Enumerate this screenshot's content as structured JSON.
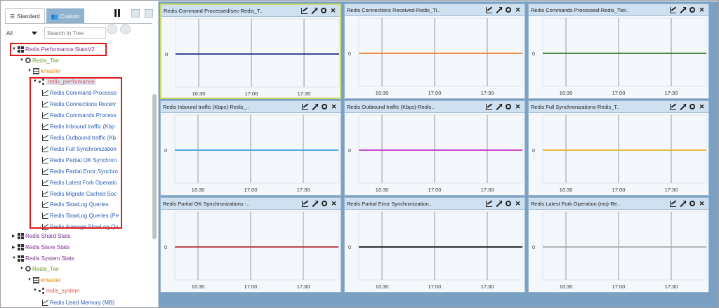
{
  "tabs": [
    {
      "label": "Standard",
      "active": true
    },
    {
      "label": "Custom",
      "active": false
    }
  ],
  "filter": {
    "selected": "All",
    "placeholder": "Search In Tree"
  },
  "tree": [
    {
      "label": "Redis Performance StatsV2",
      "color": "#7b2d8e",
      "icon": "dashboard-grid-icon",
      "indent": 0,
      "expanded": true
    },
    {
      "label": "Redis_Tier",
      "color": "#6e9f1f",
      "icon": "tier-gear-icon",
      "indent": 1,
      "expanded": true
    },
    {
      "label": "kmaster",
      "color": "#e08a00",
      "icon": "server-icon",
      "indent": 2,
      "expanded": true
    },
    {
      "label": "redis_performance",
      "color": "#d9534f",
      "icon": "share-node-icon",
      "indent": 3,
      "expanded": true,
      "selected": true
    },
    {
      "label": "Redis Command Processe",
      "color": "#2c5eb4",
      "icon": "graph-icon",
      "indent": 4
    },
    {
      "label": "Redis Connections Receiv",
      "color": "#2c5eb4",
      "icon": "graph-icon",
      "indent": 4
    },
    {
      "label": "Redis Commands Process",
      "color": "#2c5eb4",
      "icon": "graph-icon",
      "indent": 4
    },
    {
      "label": "Redis Inbound traffic (Kbp",
      "color": "#2c5eb4",
      "icon": "graph-icon",
      "indent": 4
    },
    {
      "label": "Redis Outbound traffic (Kb",
      "color": "#2c5eb4",
      "icon": "graph-icon",
      "indent": 4
    },
    {
      "label": "Redis Full Synchronization",
      "color": "#2c5eb4",
      "icon": "graph-icon",
      "indent": 4
    },
    {
      "label": "Redis Partial OK Synchron",
      "color": "#2c5eb4",
      "icon": "graph-icon",
      "indent": 4
    },
    {
      "label": "Redis Partial Error Synchro",
      "color": "#2c5eb4",
      "icon": "graph-icon",
      "indent": 4
    },
    {
      "label": "Redis Latest Fork Operatio",
      "color": "#2c5eb4",
      "icon": "graph-icon",
      "indent": 4
    },
    {
      "label": "Redis Migrate Cached Soc",
      "color": "#2c5eb4",
      "icon": "graph-icon",
      "indent": 4
    },
    {
      "label": "Redis SlowLog Queries",
      "color": "#2c5eb4",
      "icon": "graph-icon",
      "indent": 4
    },
    {
      "label": "Redis SlowLog Queries (Pe",
      "color": "#2c5eb4",
      "icon": "graph-icon",
      "indent": 4
    },
    {
      "label": "Redis Average SlowLog Qu",
      "color": "#2c5eb4",
      "icon": "graph-icon",
      "indent": 4
    },
    {
      "label": "Redis Shard Stats",
      "color": "#7b2d8e",
      "icon": "dashboard-grid-icon",
      "indent": 0,
      "expanded": false
    },
    {
      "label": "Redis Slave Stats",
      "color": "#7b2d8e",
      "icon": "dashboard-grid-icon",
      "indent": 0,
      "expanded": false
    },
    {
      "label": "Redis System Stats",
      "color": "#7b2d8e",
      "icon": "dashboard-grid-icon",
      "indent": 0,
      "expanded": true
    },
    {
      "label": "Redis_Tier",
      "color": "#6e9f1f",
      "icon": "tier-gear-icon",
      "indent": 1,
      "expanded": true
    },
    {
      "label": "kmaster",
      "color": "#e08a00",
      "icon": "server-icon",
      "indent": 2,
      "expanded": true
    },
    {
      "label": "redis_system",
      "color": "#d9534f",
      "icon": "share-node-icon",
      "indent": 3,
      "expanded": true
    },
    {
      "label": "Redis Used Memory (MB)",
      "color": "#2c5eb4",
      "icon": "graph-icon",
      "indent": 4
    }
  ],
  "widgets": [
    {
      "title": "Redis Command Processed/sec-Redis_T..",
      "line_color": "#1f2d8a",
      "selected": true
    },
    {
      "title": "Redis Connections Received-Redis_Ti..",
      "line_color": "#f07f2a"
    },
    {
      "title": "Redis Commands Processed-Redis_Tier..",
      "line_color": "#2a7a2a"
    },
    {
      "title": "Redis Inbound traffic (Kbps)-Redis_..",
      "line_color": "#3a9fd8"
    },
    {
      "title": "Redis Outbound traffic (Kbps)-Redis..",
      "line_color": "#c52fc5"
    },
    {
      "title": "Redis Full Synchronizations-Redis_T..",
      "line_color": "#e8b31a"
    },
    {
      "title": "Redis Partial OK Synchronizations -..",
      "line_color": "#b03030"
    },
    {
      "title": "Redis Partial Error Synchronization..",
      "line_color": "#111111"
    },
    {
      "title": "Redis Latest Fork Operation (ms)-Re..",
      "line_color": "#a8a8a8"
    }
  ],
  "chart_common": {
    "y_label": "0",
    "x_ticks": [
      "16:30",
      "17:00",
      "17:30"
    ]
  }
}
